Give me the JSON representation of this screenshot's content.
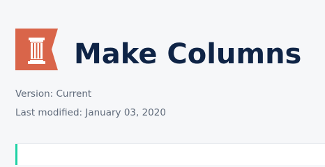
{
  "page": {
    "title": "Make Columns",
    "logo_icon": "column-pillar-icon",
    "version_text": "Version: Current",
    "last_modified_text": "Last modified: January 03, 2020"
  },
  "colors": {
    "background": "#f6f7f9",
    "title": "#0f2446",
    "meta_text": "#5f6a7a",
    "logo": "#d9654a",
    "accent": "#1ed1a4"
  }
}
